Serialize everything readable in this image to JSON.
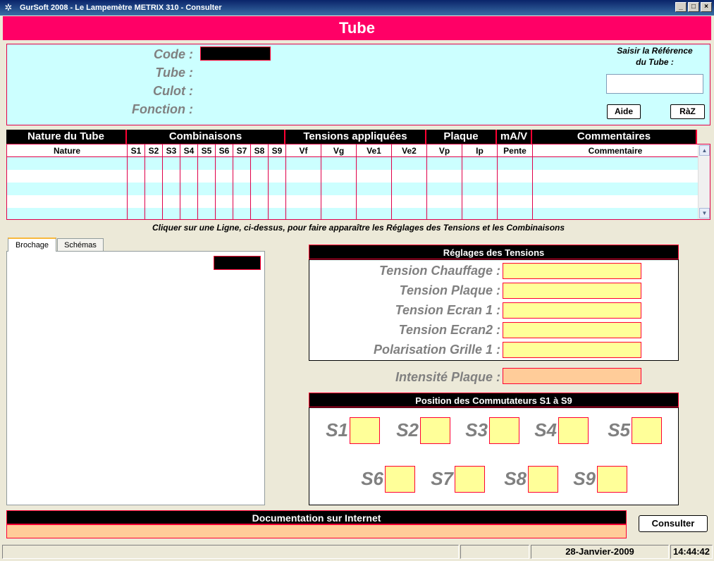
{
  "window": {
    "title": "GurSoft 2008  -  Le Lampemètre METRIX  310  -  Consulter"
  },
  "header": {
    "title": "Tube"
  },
  "search": {
    "labels": {
      "code": "Code :",
      "tube": "Tube :",
      "culot": "Culot :",
      "fonction": "Fonction :"
    },
    "ref_label_line1": "Saisir la Référence",
    "ref_label_line2": "du Tube :",
    "ref_value": "",
    "aide": "Aide",
    "raz": "RàZ"
  },
  "grid": {
    "group_headers": [
      "Nature du Tube",
      "Combinaisons",
      "Tensions appliquées",
      "Plaque",
      "mA/V",
      "Commentaires"
    ],
    "columns": [
      "Nature",
      "S1",
      "S2",
      "S3",
      "S4",
      "S5",
      "S6",
      "S7",
      "S8",
      "S9",
      "Vf",
      "Vg",
      "Ve1",
      "Ve2",
      "Vp",
      "Ip",
      "Pente",
      "Commentaire"
    ],
    "rows": [
      [],
      [],
      [],
      [],
      []
    ]
  },
  "hint": "Cliquer sur une Ligne, ci-dessus,  pour faire apparaître les Réglages des Tensions et les Combinaisons",
  "tabs": [
    {
      "label": "Brochage",
      "active": true
    },
    {
      "label": "Schémas",
      "active": false
    }
  ],
  "reglages": {
    "title": "Réglages des Tensions",
    "labels": [
      "Tension Chauffage :",
      "Tension Plaque :",
      "Tension Ecran 1 :",
      "Tension Ecran2 :",
      "Polarisation Grille 1 :"
    ],
    "intensite_label": "Intensité Plaque :"
  },
  "commutateurs": {
    "title": "Position des Commutateurs S1 à S9",
    "labels": [
      "S1",
      "S2",
      "S3",
      "S4",
      "S5",
      "S6",
      "S7",
      "S8",
      "S9"
    ]
  },
  "documentation": {
    "title": "Documentation sur Internet",
    "value": ""
  },
  "consulter": "Consulter",
  "status": {
    "date": "28-Janvier-2009",
    "time": "14:44:42"
  },
  "colors": {
    "accent": "#ff0066",
    "panel": "#ccffff",
    "field": "#ffff99",
    "field_orange": "#ffcc99"
  }
}
